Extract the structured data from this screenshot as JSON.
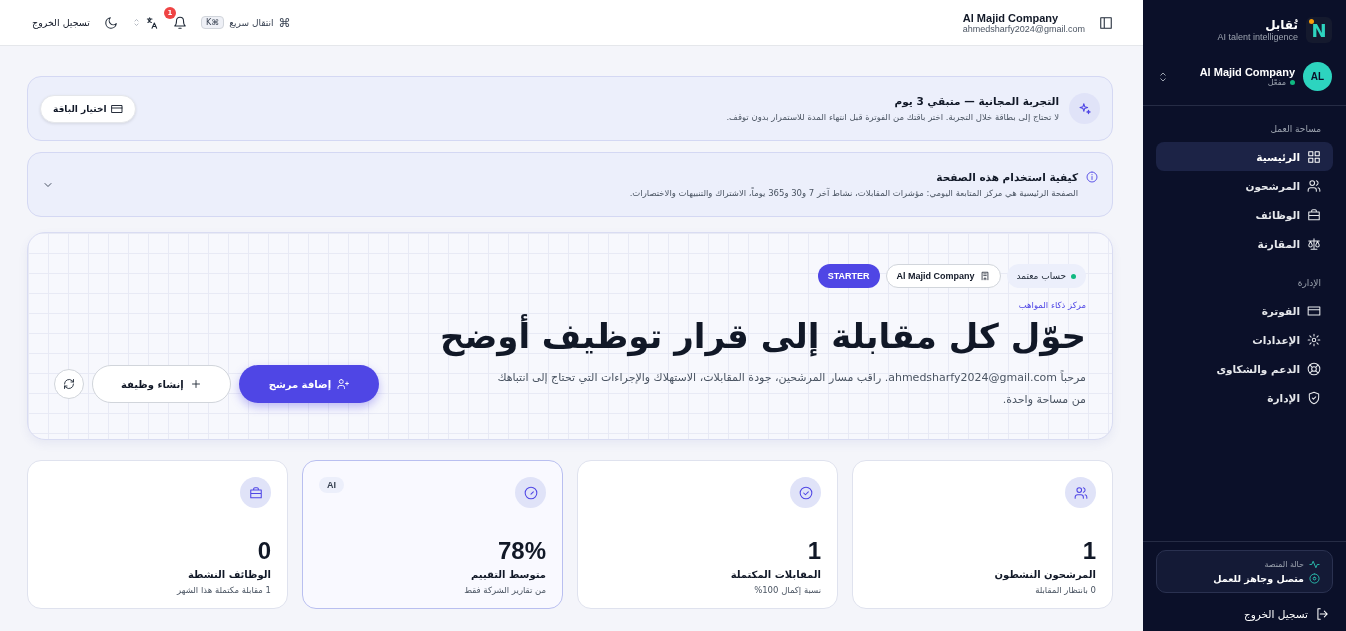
{
  "sidebar": {
    "logo_letter": "N",
    "brand": "تُقابل",
    "tagline": "AI talent intelligence",
    "org": {
      "avatar": "AL",
      "name": "Al Majid Company",
      "status": "مفعّل"
    },
    "sections": [
      {
        "title": "مساحة العمل",
        "items": [
          {
            "label": "الرئيسية",
            "kind": "grid",
            "selected": true
          },
          {
            "label": "المرشحون",
            "kind": "users",
            "selected": false
          },
          {
            "label": "الوظائف",
            "kind": "briefcase",
            "selected": false
          },
          {
            "label": "المقارنة",
            "kind": "scale",
            "selected": false
          }
        ]
      },
      {
        "title": "الإدارة",
        "items": [
          {
            "label": "الفوترة",
            "kind": "card",
            "selected": false
          },
          {
            "label": "الإعدادات",
            "kind": "gear",
            "selected": false
          },
          {
            "label": "الدعم والشكاوى",
            "kind": "lifebuoy",
            "selected": false
          },
          {
            "label": "الإدارة",
            "kind": "shield",
            "selected": false
          }
        ]
      }
    ],
    "platform": {
      "title": "حالة المنصة",
      "status": "متصل وجاهز للعمل"
    },
    "logout": "تسجيل الخروج"
  },
  "header": {
    "company": "Al Majid Company",
    "email": "ahmedsharfy2024@gmail.com",
    "quick_nav": {
      "symbol": "⌘",
      "label": "انتقال سريع",
      "shortcut": "⌘K"
    },
    "notifications": "1",
    "logout": "تسجيل الخروج"
  },
  "trial": {
    "title": "التجربة المجانية — متبقي 3 يوم",
    "text": "لا تحتاج إلى بطاقة خلال التجربة. اختر باقتك من الفوترة قبل انتهاء المدة للاستمرار بدون توقف.",
    "button": "اختيار الباقة"
  },
  "howto": {
    "title": "كيفية استخدام هذه الصفحة",
    "text": "الصفحة الرئيسية هي مركز المتابعة اليومي: مؤشرات المقابلات، نشاط آخر 7 و30 و365 يوماً، الاشتراك والتنبيهات والاختصارات.",
    "expanded": false
  },
  "hero": {
    "badges": [
      {
        "kind": "status",
        "label": "حساب معتمد"
      },
      {
        "kind": "company",
        "label": "Al Majid Company"
      },
      {
        "kind": "plan",
        "label": "STARTER"
      }
    ],
    "eyebrow": "مركز ذكاء المواهب",
    "title": "حوّل كل مقابلة إلى قرار توظيف أوضح",
    "text": "مرحباً ahmedsharfy2024@gmail.com. راقب مسار المرشحين، جودة المقابلات، الاستهلاك والإجراءات التي تحتاج إلى انتباهك من مساحة واحدة.",
    "primary": "إضافة مرشح",
    "secondary": "إنشاء وظيفة"
  },
  "stats": [
    {
      "kind": "users",
      "value": "1",
      "label": "المرشحون النشطون",
      "note": "0 بانتظار المقابلة",
      "highlighted": false
    },
    {
      "kind": "check",
      "value": "1",
      "label": "المقابلات المكتملة",
      "note": "نسبة إكمال 100%",
      "highlighted": false
    },
    {
      "kind": "gauge",
      "value": "78%",
      "label": "متوسط التقييم",
      "note": "من تقارير الشركة فقط",
      "badge": "AI",
      "highlighted": true
    },
    {
      "kind": "briefcase",
      "value": "0",
      "label": "الوظائف النشطة",
      "note": "1 مقابلة مكتملة هذا الشهر",
      "highlighted": false
    }
  ]
}
